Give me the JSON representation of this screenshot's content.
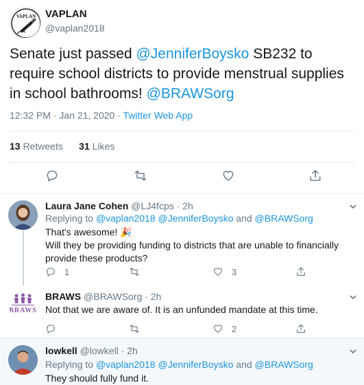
{
  "main_tweet": {
    "author_name": "VAPLAN",
    "author_handle": "@vaplan2018",
    "avatar_icon": "vaplan-logo-pen",
    "text_segments": [
      {
        "text": "Senate just passed ",
        "link": false
      },
      {
        "text": "@JenniferBoysko",
        "link": true
      },
      {
        "text": "  SB232 to require school districts to provide menstrual supplies in school bathrooms! ",
        "link": false
      },
      {
        "text": "@BRAWSorg",
        "link": true
      }
    ],
    "time": "12:32 PM · Jan 21, 2020 · ",
    "source": "Twitter Web App",
    "retweets_count": "13",
    "retweets_label": "Retweets",
    "likes_count": "31",
    "likes_label": "Likes"
  },
  "replies": [
    {
      "name": "Laura Jane Cohen",
      "handle": "@LJ4fcps",
      "time": "· 2h",
      "replying_prefix": "Replying to ",
      "replying_to_1": "@vaplan2018",
      "replying_to_2": "@JenniferBoysko",
      "replying_and": " and ",
      "replying_to_3": "@BRAWSorg",
      "text_line1": "That's awesome! 🎉",
      "text_line2": "Will they be providing funding to districts that are unable to financially provide these products?",
      "reply_count": "1",
      "retweet_count": "",
      "like_count": "3"
    },
    {
      "name": "BRAWS",
      "handle": "@BRAWSorg",
      "time": "· 2h",
      "avatar_text": "BRAWS",
      "text": "Not that we are aware of. It is an unfunded mandate at this time.",
      "reply_count": "",
      "retweet_count": "",
      "like_count": "2"
    },
    {
      "name": "lowkell",
      "handle": "@lowkell",
      "time": "· 2h",
      "replying_prefix": "Replying to ",
      "replying_to_1": "@vaplan2018",
      "replying_to_2": "@JenniferBoysko",
      "replying_and": " and ",
      "replying_to_3": "@BRAWSorg",
      "text": "They should fully fund it."
    }
  ],
  "colors": {
    "link": "#1b95e0",
    "muted": "#657786",
    "text": "#14171a",
    "divider": "#e6ecf0",
    "braws_purple": "#8a5aa8",
    "highlight_bg": "#f5f8fa"
  }
}
